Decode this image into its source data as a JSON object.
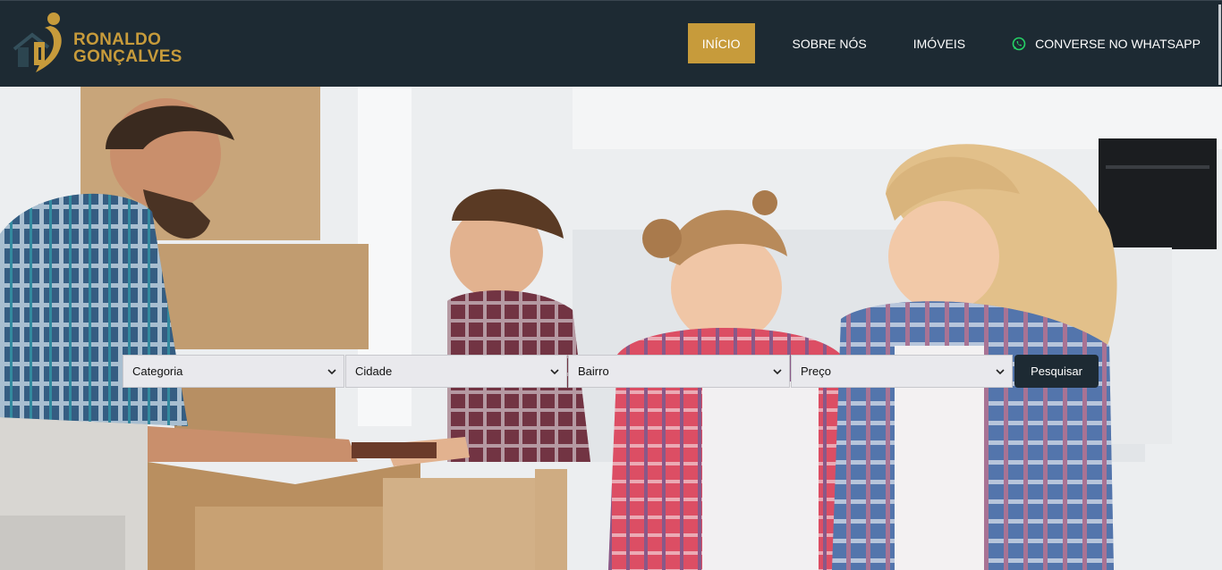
{
  "brand": {
    "line1": "RONALDO",
    "line2": "GONÇALVES"
  },
  "nav": {
    "items": [
      {
        "label": "INÍCIO"
      },
      {
        "label": "SOBRE NÓS"
      },
      {
        "label": "IMÓVEIS"
      },
      {
        "label": "CONVERSE NO WHATSAPP",
        "icon": "whatsapp-icon"
      }
    ]
  },
  "hero": {
    "image": "family-moving-boxes-photo"
  },
  "search": {
    "selects": [
      {
        "value": "Categoria"
      },
      {
        "value": "Cidade"
      },
      {
        "value": "Bairro"
      },
      {
        "value": "Preço"
      }
    ],
    "button_label": "Pesquisar"
  },
  "colors": {
    "navbar": "#1d2a33",
    "accent": "#c79b3b",
    "whatsapp": "#25d366"
  }
}
